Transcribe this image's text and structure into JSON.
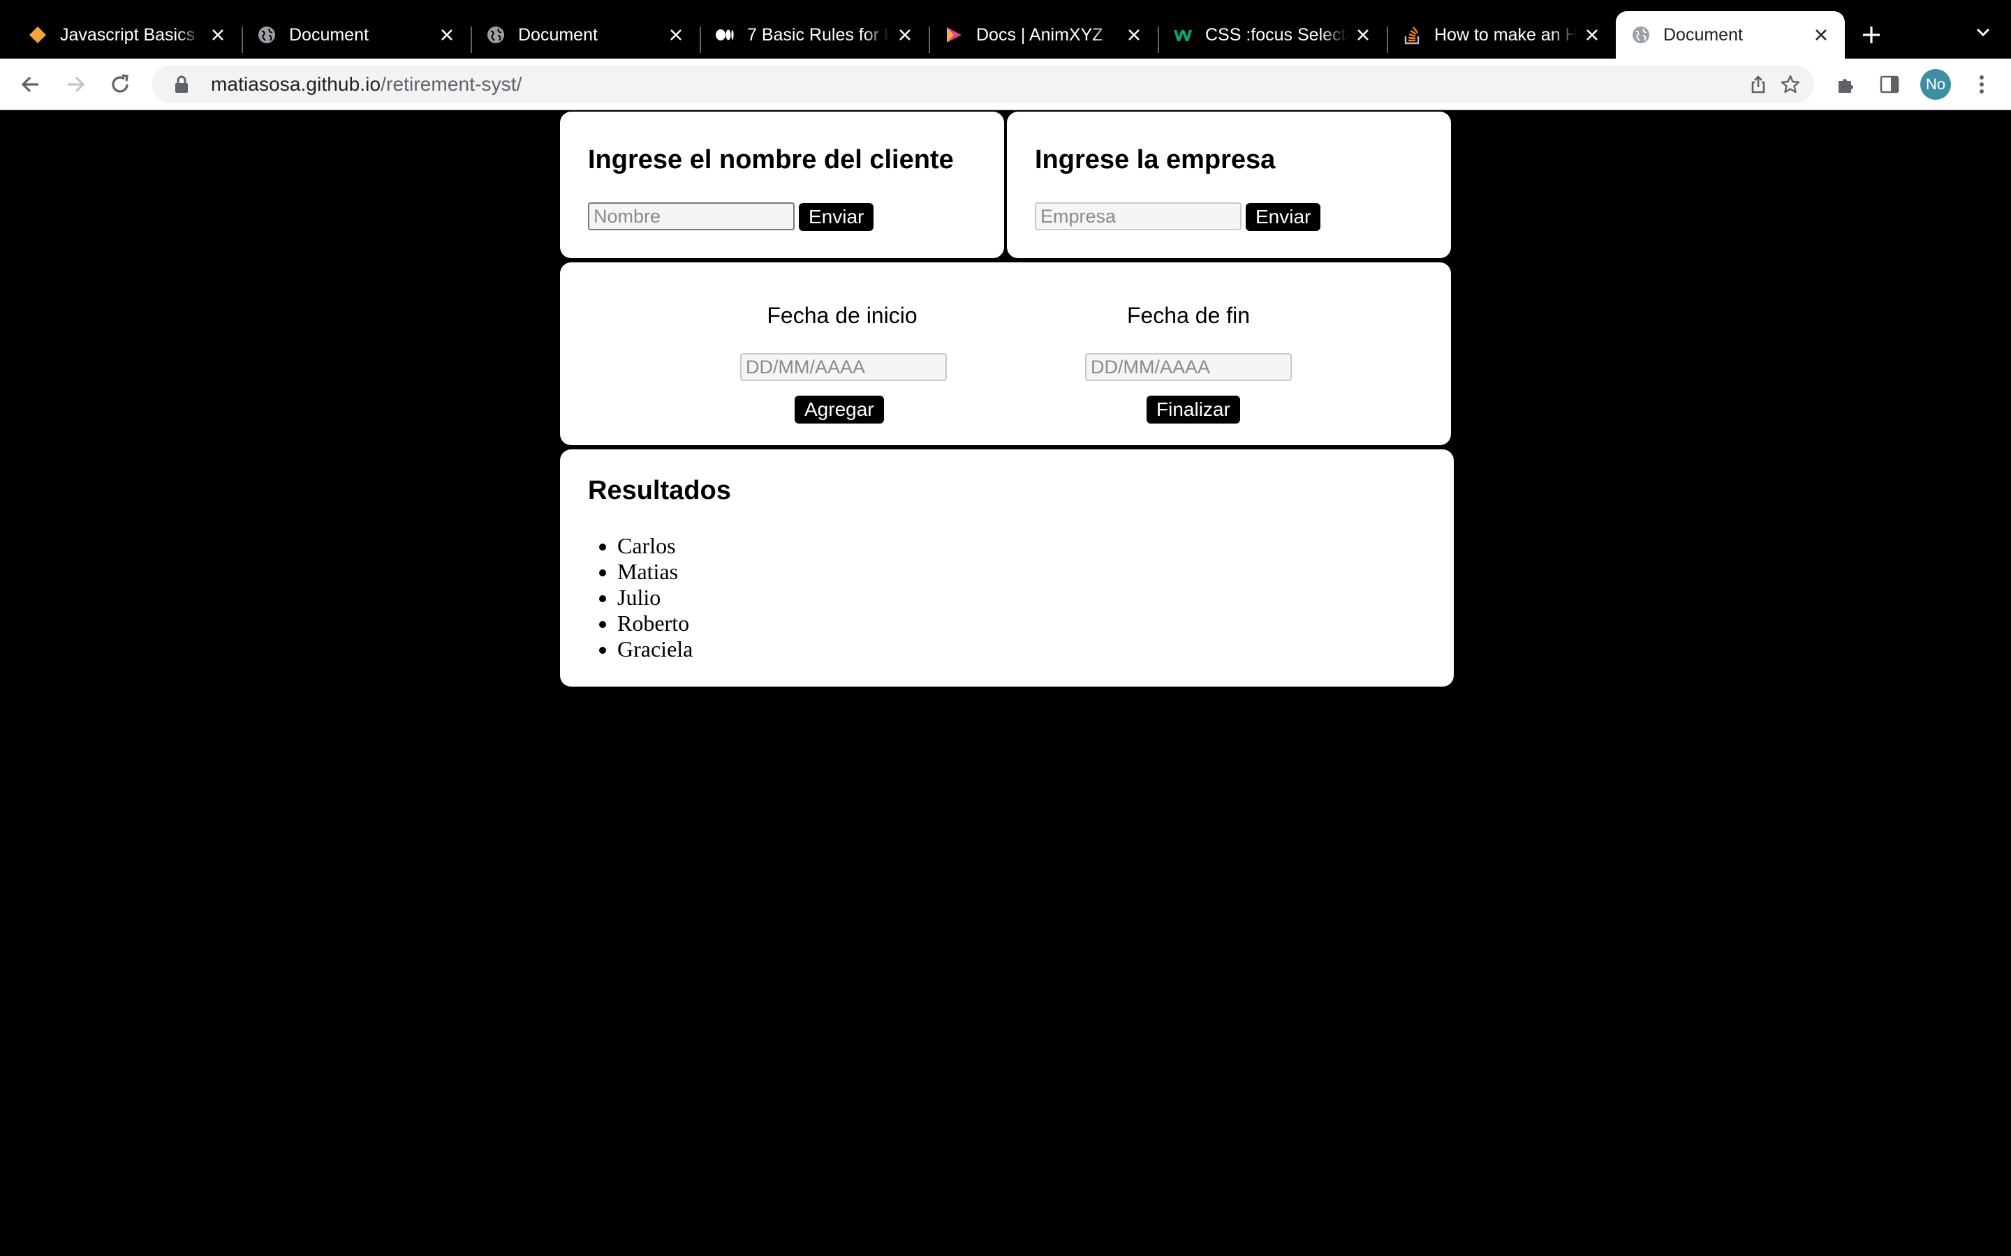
{
  "browser": {
    "tabs": [
      {
        "title": "Javascript Basics",
        "icon": "diamond-icon",
        "active": false
      },
      {
        "title": "Document",
        "icon": "globe-icon",
        "active": false
      },
      {
        "title": "Document",
        "icon": "globe-icon",
        "active": false
      },
      {
        "title": "7 Basic Rules for B",
        "icon": "medium-icon",
        "active": false
      },
      {
        "title": "Docs | AnimXYZ",
        "icon": "play-triangle-icon",
        "active": false
      },
      {
        "title": "CSS :focus Selector",
        "icon": "w3schools-icon",
        "active": false
      },
      {
        "title": "How to make an H",
        "icon": "stackoverflow-icon",
        "active": false
      },
      {
        "title": "Document",
        "icon": "globe-icon",
        "active": true
      }
    ],
    "url_host": "matiasosa.github.io",
    "url_path": "/retirement-syst/",
    "profile_initials": "No",
    "profile_color": "#3e8ea2"
  },
  "client_card": {
    "heading": "Ingrese el nombre del cliente",
    "input_placeholder": "Nombre",
    "button_label": "Enviar"
  },
  "company_card": {
    "heading": "Ingrese la empresa",
    "input_placeholder": "Empresa",
    "button_label": "Enviar"
  },
  "dates_card": {
    "start_label": "Fecha de inicio",
    "start_placeholder": "DD/MM/AAAA",
    "start_button": "Agregar",
    "end_label": "Fecha de fin",
    "end_placeholder": "DD/MM/AAAA",
    "end_button": "Finalizar"
  },
  "results_card": {
    "heading": "Resultados",
    "items": [
      "Carlos",
      "Matias",
      "Julio",
      "Roberto",
      "Graciela"
    ]
  }
}
